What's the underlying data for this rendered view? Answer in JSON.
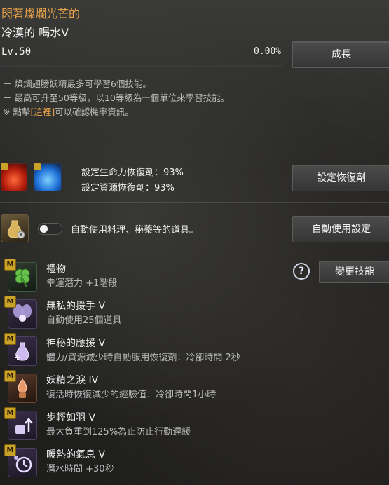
{
  "header": {
    "title_line1": "閃著燦爛光芒的",
    "title_line2": "冷漠的 喝水V",
    "level": "Lv.50",
    "progress_percent": "0.00%",
    "progress_value": 0.0,
    "grow_button": "成長"
  },
  "info": {
    "line1": "－ 燦爛翅膀妖精最多可學習6個技能。",
    "line2": "－ 最高可升至50等級，以10等級為一個單位來學習技能。",
    "line3_prefix": "※ 點擊",
    "line3_link": "[這裡]",
    "line3_suffix": "可以確認機率資訊。"
  },
  "recovery": {
    "hp_label": "設定生命力恢復劑：93%",
    "mp_label": "設定資源恢復劑：93%",
    "button": "設定恢復劑"
  },
  "auto_use": {
    "label": "自動使用料理、秘藥等的道具。",
    "toggle_on": false,
    "button": "自動使用設定"
  },
  "skills_header": {
    "help_icon_text": "?",
    "change_button": "變更技能"
  },
  "skills": [
    {
      "badge": "M",
      "icon": "clover-icon",
      "name": "禮物",
      "desc": "幸運潛力 +1階段"
    },
    {
      "badge": "M",
      "icon": "fairy-icon",
      "name": "無私的援手 V",
      "desc": "自動使用25個道具"
    },
    {
      "badge": "M",
      "icon": "potion-plus-icon",
      "name": "神秘的應援 V",
      "desc": "體力/資源減少時自動服用恢復劑：冷卻時間 2秒"
    },
    {
      "badge": "M",
      "icon": "tear-vase-icon",
      "name": "妖精之淚 IV",
      "desc": "復活時恢復減少的經驗值：冷卻時間1小時"
    },
    {
      "badge": "M",
      "icon": "weight-arrow-icon",
      "name": "步輕如羽 V",
      "desc": "最大負重到125%為止防止行動遲緩"
    },
    {
      "badge": "M",
      "icon": "timer-icon",
      "name": "暖熱的氣息 V",
      "desc": "潛水時間 +30秒"
    }
  ]
}
